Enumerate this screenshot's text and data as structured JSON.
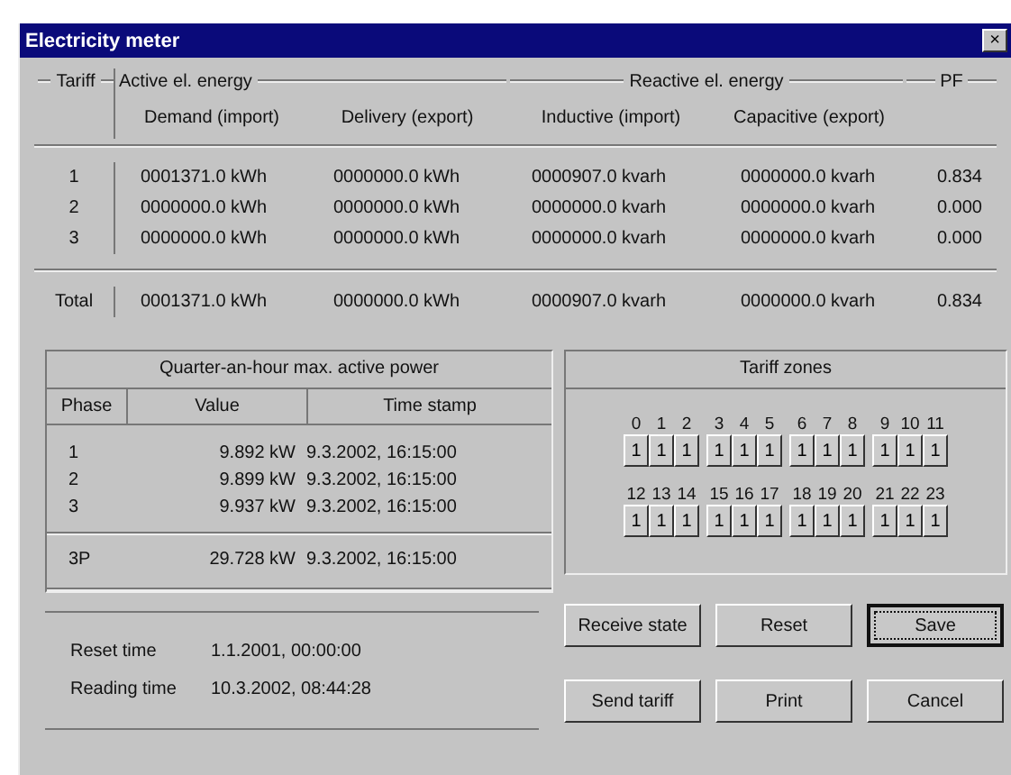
{
  "window": {
    "title": "Electricity meter",
    "close": "×"
  },
  "energy": {
    "tariff_label": "Tariff",
    "active_label": "Active el. energy",
    "reactive_label": "Reactive el. energy",
    "pf_label": "PF",
    "columns": [
      "",
      "Demand (import)",
      "Delivery (export)",
      "Inductive (import)",
      "Capacitive (export)",
      ""
    ],
    "rows": [
      [
        "1",
        "0001371.0 kWh",
        "0000000.0 kWh",
        "0000907.0 kvarh",
        "0000000.0 kvarh",
        "0.834"
      ],
      [
        "2",
        "0000000.0 kWh",
        "0000000.0 kWh",
        "0000000.0 kvarh",
        "0000000.0 kvarh",
        "0.000"
      ],
      [
        "3",
        "0000000.0 kWh",
        "0000000.0 kWh",
        "0000000.0 kvarh",
        "0000000.0 kvarh",
        "0.000"
      ]
    ],
    "total": [
      "Total",
      "0001371.0 kWh",
      "0000000.0 kWh",
      "0000907.0 kvarh",
      "0000000.0 kvarh",
      "0.834"
    ]
  },
  "power": {
    "title": "Quarter-an-hour max. active power",
    "columns": [
      "Phase",
      "Value",
      "Time stamp"
    ],
    "rows": [
      [
        "1",
        "9.892 kW",
        "9.3.2002, 16:15:00"
      ],
      [
        "2",
        "9.899 kW",
        "9.3.2002, 16:15:00"
      ],
      [
        "3",
        "9.937 kW",
        "9.3.2002, 16:15:00"
      ]
    ],
    "total": [
      "3P",
      "29.728 kW",
      "9.3.2002, 16:15:00"
    ]
  },
  "times": [
    {
      "label": "Reset time",
      "value": "1.1.2001, 00:00:00"
    },
    {
      "label": "Reading time",
      "value": "10.3.2002, 08:44:28"
    }
  ],
  "zones": {
    "title": "Tariff zones",
    "hours": [
      {
        "hour": "0",
        "tariff": "1"
      },
      {
        "hour": "1",
        "tariff": "1"
      },
      {
        "hour": "2",
        "tariff": "1"
      },
      {
        "hour": "3",
        "tariff": "1"
      },
      {
        "hour": "4",
        "tariff": "1"
      },
      {
        "hour": "5",
        "tariff": "1"
      },
      {
        "hour": "6",
        "tariff": "1"
      },
      {
        "hour": "7",
        "tariff": "1"
      },
      {
        "hour": "8",
        "tariff": "1"
      },
      {
        "hour": "9",
        "tariff": "1"
      },
      {
        "hour": "10",
        "tariff": "1"
      },
      {
        "hour": "11",
        "tariff": "1"
      },
      {
        "hour": "12",
        "tariff": "1"
      },
      {
        "hour": "13",
        "tariff": "1"
      },
      {
        "hour": "14",
        "tariff": "1"
      },
      {
        "hour": "15",
        "tariff": "1"
      },
      {
        "hour": "16",
        "tariff": "1"
      },
      {
        "hour": "17",
        "tariff": "1"
      },
      {
        "hour": "18",
        "tariff": "1"
      },
      {
        "hour": "19",
        "tariff": "1"
      },
      {
        "hour": "20",
        "tariff": "1"
      },
      {
        "hour": "21",
        "tariff": "1"
      },
      {
        "hour": "22",
        "tariff": "1"
      },
      {
        "hour": "23",
        "tariff": "1"
      }
    ]
  },
  "buttons": [
    {
      "label": "Receive state",
      "default": false
    },
    {
      "label": "Reset",
      "default": false
    },
    {
      "label": "Save",
      "default": true
    },
    {
      "label": "Send tariff",
      "default": false
    },
    {
      "label": "Print",
      "default": false
    },
    {
      "label": "Cancel",
      "default": false
    }
  ]
}
